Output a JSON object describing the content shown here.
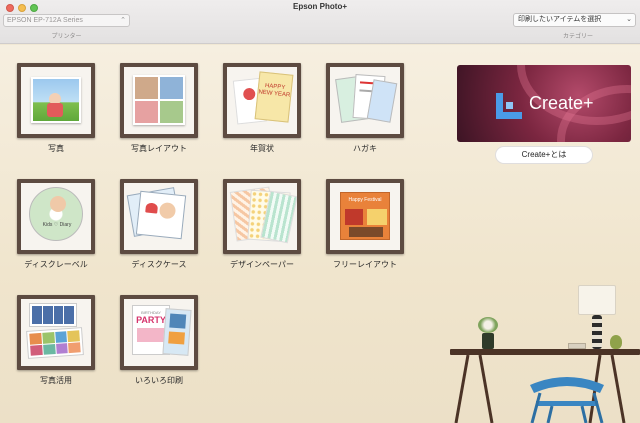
{
  "window": {
    "title": "Epson Photo+"
  },
  "printer": {
    "selected": "EPSON EP-712A Series",
    "caption": "プリンター"
  },
  "category": {
    "selected": "印刷したいアイテムを選択",
    "caption": "カテゴリー"
  },
  "tiles": [
    {
      "label": "写真"
    },
    {
      "label": "写真レイアウト"
    },
    {
      "label": "年賀状"
    },
    {
      "label": "ハガキ"
    },
    {
      "label": "ディスクレーベル"
    },
    {
      "label": "ディスクケース"
    },
    {
      "label": "デザインペーパー"
    },
    {
      "label": "フリーレイアウト"
    },
    {
      "label": "写真活用"
    },
    {
      "label": "いろいろ印刷"
    }
  ],
  "promo": {
    "text": "Create+",
    "about_button": "Create+とは"
  },
  "thumb_text": {
    "nengajo": "HAPPY NEW YEAR",
    "disc_label": "Kids ♡ Diary",
    "party": "PARTY",
    "party_sub": "BIRTHDAY",
    "free_layout": "Happy Festival"
  },
  "colors": {
    "frame": "#5d4b41",
    "promo_bg": "#7b2640",
    "logo": "#4a9be8"
  }
}
